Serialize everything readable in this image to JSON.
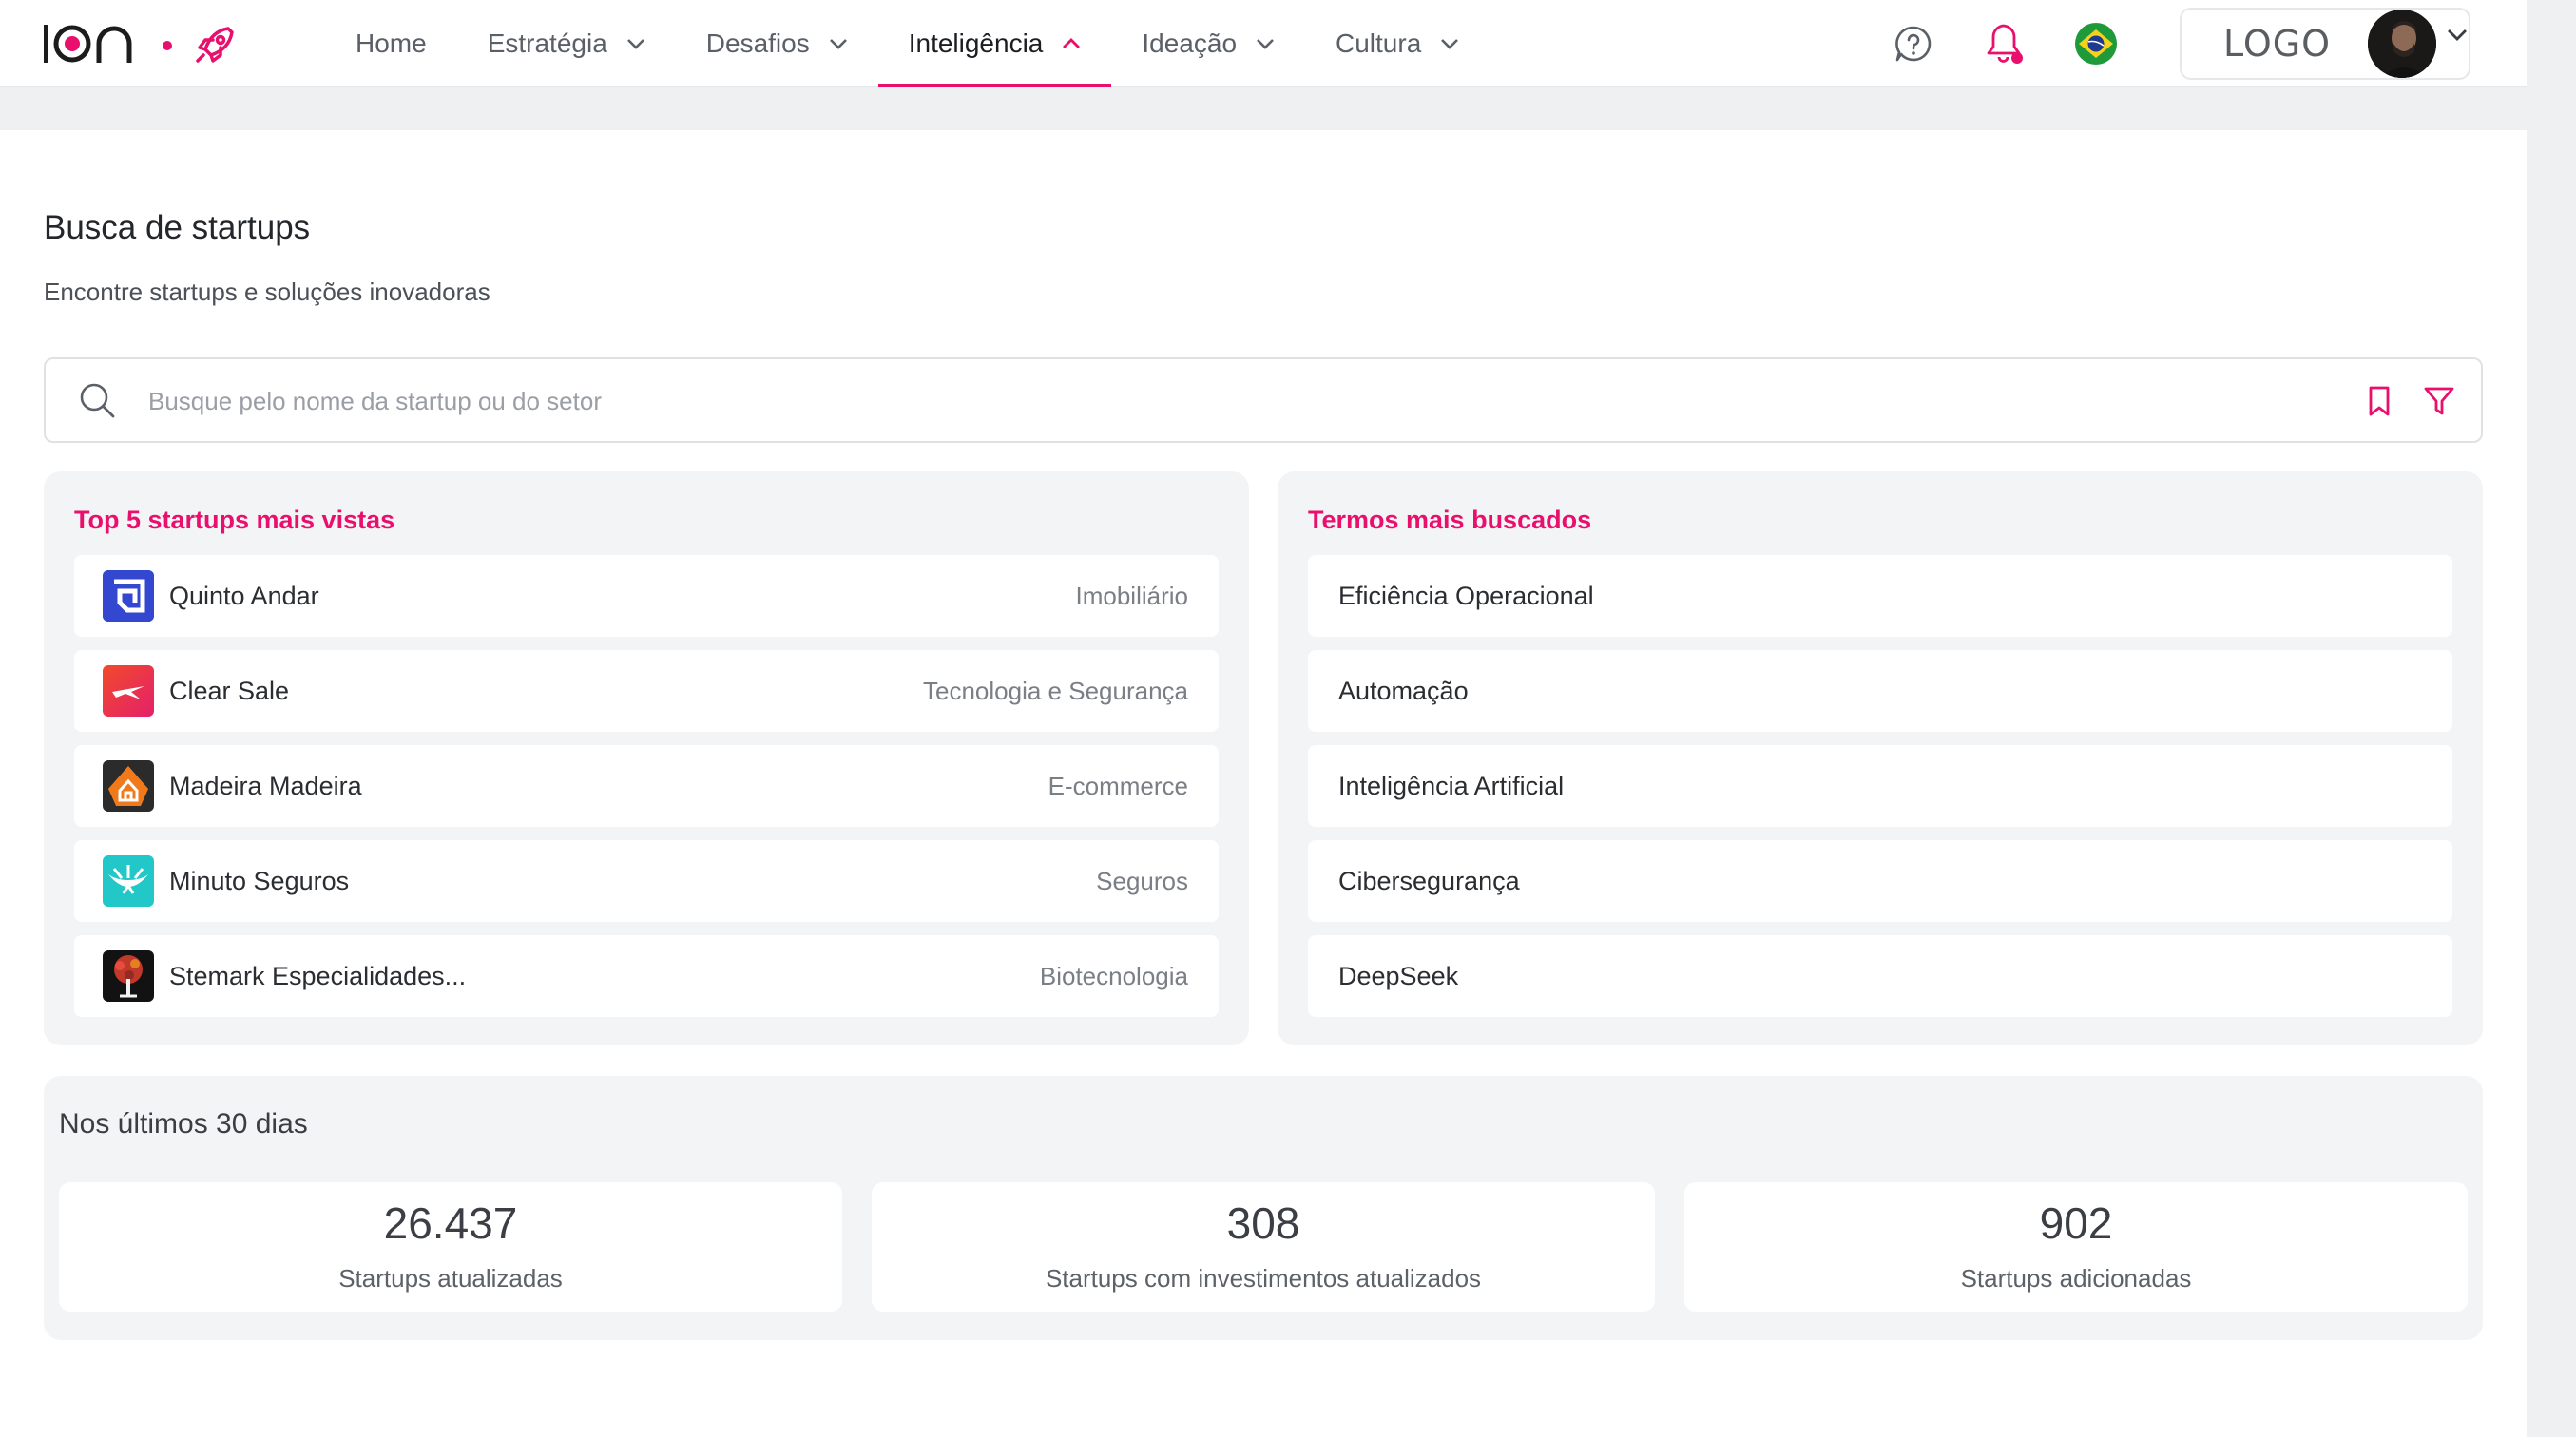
{
  "brand": {
    "name": "ion",
    "accent": "#e8106c"
  },
  "nav": {
    "items": [
      {
        "label": "Home",
        "has_dropdown": false,
        "active": false
      },
      {
        "label": "Estratégia",
        "has_dropdown": true,
        "active": false
      },
      {
        "label": "Desafios",
        "has_dropdown": true,
        "active": false
      },
      {
        "label": "Inteligência",
        "has_dropdown": true,
        "active": true
      },
      {
        "label": "Ideação",
        "has_dropdown": true,
        "active": false
      },
      {
        "label": "Cultura",
        "has_dropdown": true,
        "active": false
      }
    ]
  },
  "toolbar": {
    "icons": [
      "help-chat-icon",
      "notification-bell-icon",
      "brazil-flag-icon"
    ],
    "account_logo": "LOGO"
  },
  "header": {
    "title": "Busca de startups",
    "subtitle": "Encontre startups e soluções inovadoras"
  },
  "search": {
    "placeholder": "Busque pelo nome da startup ou do setor",
    "value": ""
  },
  "top_startups": {
    "title": "Top 5 startups mais vistas",
    "items": [
      {
        "name": "Quinto Andar",
        "sector": "Imobiliário",
        "logo_color": "#3347d1"
      },
      {
        "name": "Clear Sale",
        "sector": "Tecnologia e Segurança",
        "logo_color": "#e8305a"
      },
      {
        "name": "Madeira Madeira",
        "sector": "E-commerce",
        "logo_color": "#f07a1a"
      },
      {
        "name": "Minuto Seguros",
        "sector": "Seguros",
        "logo_color": "#1ec7c7"
      },
      {
        "name": "Stemark Especialidades...",
        "sector": "Biotecnologia",
        "logo_color": "#111111"
      }
    ]
  },
  "top_terms": {
    "title": "Termos mais buscados",
    "items": [
      "Eficiência Operacional",
      "Automação",
      "Inteligência Artificial",
      "Cibersegurança",
      "DeepSeek"
    ]
  },
  "stats": {
    "title": "Nos últimos 30 dias",
    "items": [
      {
        "value": "26.437",
        "label": "Startups atualizadas"
      },
      {
        "value": "308",
        "label": "Startups com investimentos atualizados"
      },
      {
        "value": "902",
        "label": "Startups adicionadas"
      }
    ]
  }
}
